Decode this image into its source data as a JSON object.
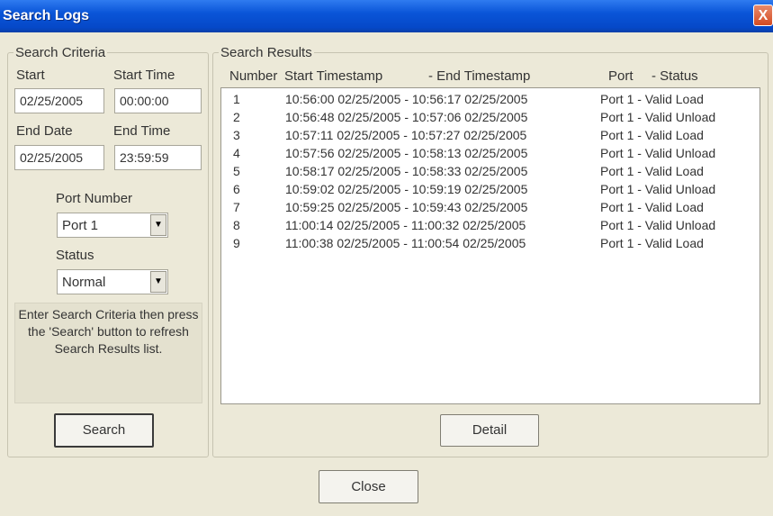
{
  "window": {
    "title": "Search Logs",
    "close_glyph": "X"
  },
  "criteria": {
    "legend": "Search Criteria",
    "start_label": "Start",
    "start_value": "02/25/2005",
    "start_time_label": "Start Time",
    "start_time_value": "00:00:00",
    "end_date_label": "End Date",
    "end_date_value": "02/25/2005",
    "end_time_label": "End Time",
    "end_time_value": "23:59:59",
    "port_label": "Port Number",
    "port_value": "Port 1",
    "status_label": "Status",
    "status_value": "Normal",
    "hint": "Enter Search Criteria then press the 'Search' button to refresh Search Results list.",
    "search_button": "Search"
  },
  "results": {
    "legend": "Search Results",
    "headers": {
      "number": "Number",
      "start": "Start Timestamp",
      "end": "- End Timestamp",
      "port": "Port",
      "status": "-  Status"
    },
    "rows": [
      {
        "number": "1",
        "range": "10:56:00 02/25/2005 - 10:56:17 02/25/2005",
        "port_status": "Port 1 - Valid Load"
      },
      {
        "number": "2",
        "range": "10:56:48 02/25/2005 - 10:57:06 02/25/2005",
        "port_status": "Port 1 - Valid Unload"
      },
      {
        "number": "3",
        "range": "10:57:11 02/25/2005 - 10:57:27 02/25/2005",
        "port_status": "Port 1 - Valid Load"
      },
      {
        "number": "4",
        "range": "10:57:56 02/25/2005 - 10:58:13 02/25/2005",
        "port_status": "Port 1 - Valid Unload"
      },
      {
        "number": "5",
        "range": "10:58:17 02/25/2005 - 10:58:33 02/25/2005",
        "port_status": "Port 1 - Valid Load"
      },
      {
        "number": "6",
        "range": "10:59:02 02/25/2005 - 10:59:19 02/25/2005",
        "port_status": "Port 1 - Valid Unload"
      },
      {
        "number": "7",
        "range": "10:59:25 02/25/2005 - 10:59:43 02/25/2005",
        "port_status": "Port 1 - Valid Load"
      },
      {
        "number": "8",
        "range": "11:00:14 02/25/2005 - 11:00:32 02/25/2005",
        "port_status": "Port 1 - Valid Unload"
      },
      {
        "number": "9",
        "range": "11:00:38 02/25/2005 - 11:00:54 02/25/2005",
        "port_status": "Port 1 - Valid Load"
      }
    ],
    "detail_button": "Detail"
  },
  "footer": {
    "close_button": "Close"
  },
  "icons": {
    "close": "close-icon",
    "dropdown": "chevron-down-icon"
  }
}
